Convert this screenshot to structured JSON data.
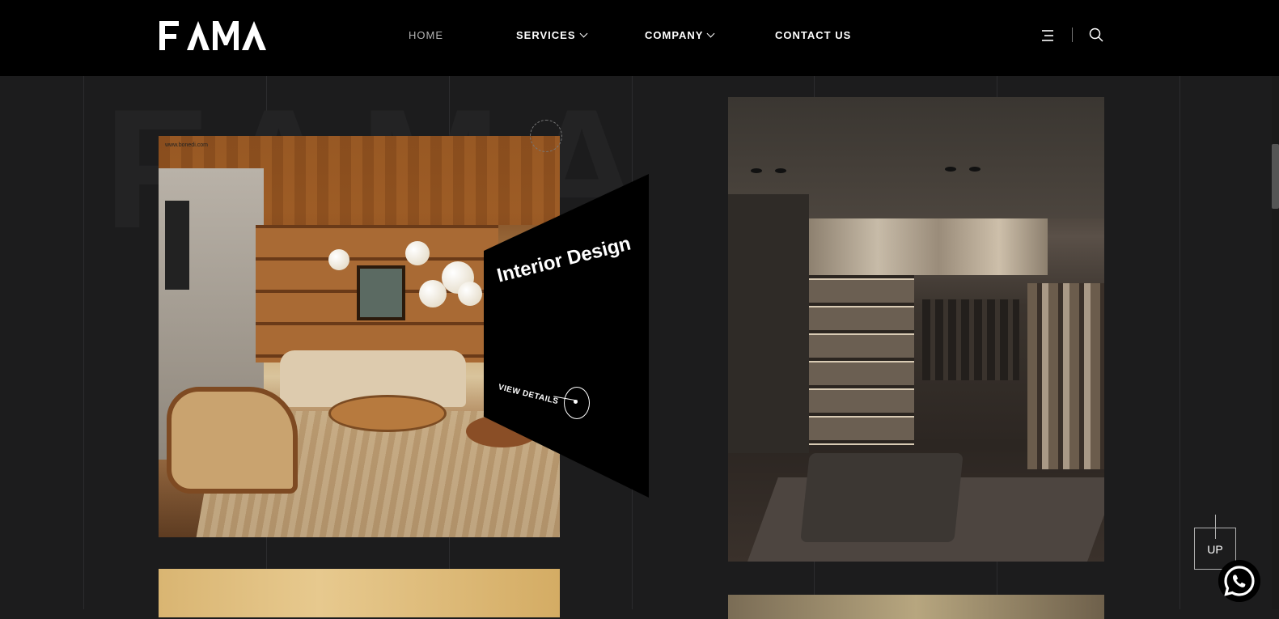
{
  "brand": {
    "logo_text": "FAMA"
  },
  "nav": {
    "items": [
      {
        "label": "HOME",
        "active": true,
        "has_dropdown": false
      },
      {
        "label": "SERVICES",
        "active": false,
        "has_dropdown": true
      },
      {
        "label": "COMPANY",
        "active": false,
        "has_dropdown": true
      },
      {
        "label": "CONTACT US",
        "active": false,
        "has_dropdown": false
      }
    ]
  },
  "header_icons": {
    "menu": "menu-icon",
    "search": "search-icon"
  },
  "watermark": {
    "text": "FAMA"
  },
  "projects": [
    {
      "image": "living-room-image",
      "credit": "www.bonedi.com"
    },
    {
      "image": "walk-in-closet-image"
    }
  ],
  "overlay": {
    "title": "Interior Design",
    "cta": "VIEW DETAILS"
  },
  "up_button": {
    "label": "UP"
  },
  "colors": {
    "background": "#1c1c1d",
    "header": "#000000",
    "nav_active": "#b3b3b3"
  }
}
